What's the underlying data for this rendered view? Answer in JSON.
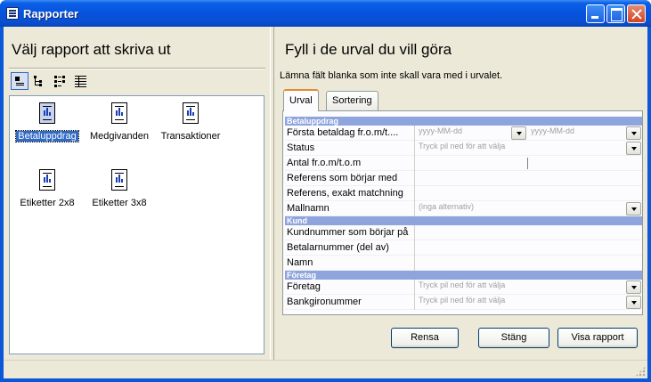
{
  "window": {
    "title": "Rapporter",
    "accent": "#0a57d8"
  },
  "left": {
    "title": "Välj rapport att skriva ut",
    "view_buttons": [
      "large-icons-icon",
      "tree-view-icon",
      "list-view-icon",
      "details-view-icon"
    ],
    "reports": [
      {
        "label": "Betaluppdrag",
        "selected": true
      },
      {
        "label": "Medgivanden",
        "selected": false
      },
      {
        "label": "Transaktioner",
        "selected": false
      },
      {
        "label": "Etiketter 2x8",
        "selected": false
      },
      {
        "label": "Etiketter 3x8",
        "selected": false
      }
    ]
  },
  "right": {
    "title": "Fyll i de urval du vill göra",
    "hint": "Lämna fält blanka som inte skall vara med i urvalet.",
    "tabs": [
      {
        "label": "Urval",
        "active": true
      },
      {
        "label": "Sortering",
        "active": false
      }
    ],
    "sections": [
      {
        "header": "Betaluppdrag",
        "fields": [
          {
            "label": "Första betaldag fr.o.m/t....",
            "value": "yyyy-MM-dd",
            "value2": "yyyy-MM-dd"
          },
          {
            "label": "Status",
            "value": "Tryck pil ned för att välja"
          },
          {
            "label": "Antal fr.o.m/t.o.m",
            "value": ""
          },
          {
            "label": "Referens som börjar med",
            "value": ""
          },
          {
            "label": "Referens, exakt matchning",
            "value": ""
          },
          {
            "label": "Mallnamn",
            "value": "(inga alternativ)"
          }
        ]
      },
      {
        "header": "Kund",
        "fields": [
          {
            "label": "Kundnummer som börjar på",
            "value": ""
          },
          {
            "label": "Betalarnummer (del av)",
            "value": ""
          },
          {
            "label": "Namn",
            "value": ""
          }
        ]
      },
      {
        "header": "Företag",
        "fields": [
          {
            "label": "Företag",
            "value": "Tryck pil ned för att välja"
          },
          {
            "label": "Bankgironummer",
            "value": "Tryck pil ned för att välja"
          }
        ]
      }
    ],
    "buttons": {
      "clear": "Rensa",
      "close": "Stäng",
      "show": "Visa rapport"
    }
  }
}
